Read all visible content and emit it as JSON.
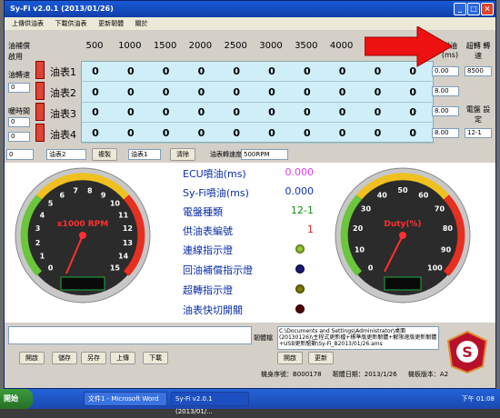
{
  "window": {
    "title": "Sy-Fi v2.0.1 (2013/01/26)"
  },
  "menu": [
    "上傳供油表",
    "下載供油表",
    "更新韌體",
    "關於"
  ],
  "table": {
    "rpm_headers": [
      "500",
      "1000",
      "1500",
      "2000",
      "2500",
      "3000",
      "3500",
      "4000",
      "4500",
      "5000"
    ],
    "rows": [
      {
        "name": "油表1",
        "values": [
          "0",
          "0",
          "0",
          "0",
          "0",
          "0",
          "0",
          "0",
          "0",
          "0"
        ]
      },
      {
        "name": "油表2",
        "values": [
          "0",
          "0",
          "0",
          "0",
          "0",
          "0",
          "0",
          "0",
          "0",
          "0"
        ]
      },
      {
        "name": "油表3",
        "values": [
          "0",
          "0",
          "0",
          "0",
          "0",
          "0",
          "0",
          "0",
          "0",
          "0"
        ]
      },
      {
        "name": "油表4",
        "values": [
          "0",
          "0",
          "0",
          "0",
          "0",
          "0",
          "0",
          "0",
          "0",
          "0"
        ]
      }
    ],
    "left_labels": [
      "油補償",
      "啟用",
      "油轉速",
      "0",
      "暖時間",
      "0",
      "0"
    ],
    "right": {
      "col1_label": "供油 (ms)",
      "col2_label": "超轉 轉速",
      "spin1": "0.00",
      "rpm_value": "8500",
      "spin2": "8.00",
      "spin3": "8.00",
      "spin4": "8.00",
      "disk_label": "電盤 設定",
      "disk_value": "12-1"
    }
  },
  "controls": {
    "sel1": "0",
    "sel2": "油表2",
    "copy": "複製",
    "sel3": "油表1",
    "clear": "清除",
    "rpm_axis_label": "油表轉速度",
    "rpm_axis_value": "500RPM"
  },
  "dashboard": {
    "rpm_gauge": {
      "label": "x1000 RPM",
      "ticks": [
        "0",
        "1",
        "2",
        "3",
        "4",
        "5",
        "6",
        "7",
        "8",
        "9",
        "10",
        "11",
        "12",
        "13",
        "14",
        "15"
      ],
      "readout": ""
    },
    "duty_gauge": {
      "label": "Duty(%)",
      "ticks": [
        "0",
        "10",
        "20",
        "30",
        "40",
        "50",
        "60",
        "70",
        "80",
        "90",
        "100"
      ],
      "readout": ""
    },
    "info": [
      {
        "label": "ECU噴油(ms)",
        "value": "0.000",
        "color": "#e040e0"
      },
      {
        "label": "Sy-Fi噴油(ms)",
        "value": "0.000",
        "color": "#1030c0"
      },
      {
        "label": "電盤種類",
        "value": "12-1",
        "color": "#109010"
      },
      {
        "label": "供油表編號",
        "value": "1",
        "color": "#d02020"
      }
    ],
    "lamps": [
      {
        "label": "連線指示燈",
        "color": "#9acd32"
      },
      {
        "label": "回油補償指示燈",
        "color": "#1a1a80"
      },
      {
        "label": "超轉指示燈",
        "color": "#808000"
      },
      {
        "label": "油表快切開關",
        "color": "#5a0000"
      }
    ]
  },
  "bottom": {
    "firmware_label": "韌體檔",
    "firmware_path": "C:\\Documents and Settings\\Administrator\\桌面(20130126)\\主程式更新檔+標準版更新韌體+解限速版更新韌體+USB更新驅動\\Sy-Fi_B2013/01/26.ams",
    "buttons": [
      "開啟",
      "儲存",
      "另存",
      "上傳",
      "下載"
    ],
    "open_btn": "開啟",
    "update_btn": "更新",
    "serial_label": "機身序號：",
    "serial": "B000178",
    "firmware_date_label": "韌體日期：",
    "firmware_date": "2013/1/26",
    "board_label": "機板版本：",
    "board": "A2"
  },
  "taskbar": {
    "start": "開始",
    "tasks": [
      "文件1 - Microsoft Word",
      "Sy-Fi v2.0.1 (2013/01/..."
    ],
    "clock": "下午 01:08"
  }
}
